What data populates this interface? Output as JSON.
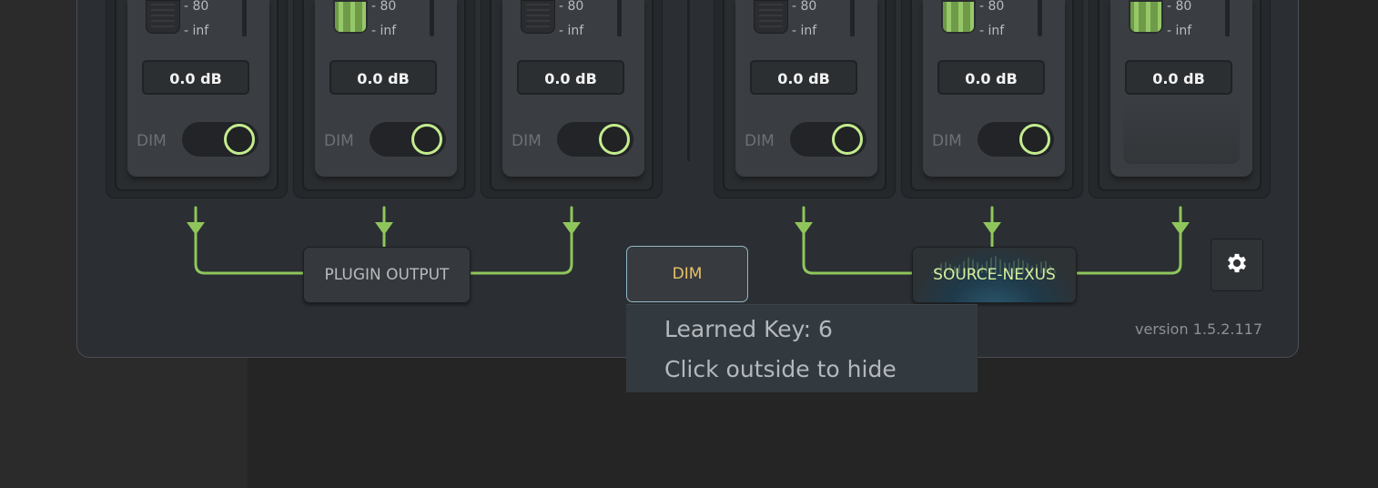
{
  "colors": {
    "accent_green": "#8fc65c",
    "toggle_ring": "#c3ec8d",
    "dim_button_text": "#e8c16a",
    "dim_button_border": "#8fb7c9",
    "source_nexus_text": "#d7ef9d",
    "panel_bg": "#2b2e32",
    "page_bg": "#252525"
  },
  "channels": [
    {
      "scale_top": "- 80",
      "scale_bottom": "- inf",
      "level": "0.0 dB",
      "dim_label": "DIM",
      "dim_on": true,
      "meter_lit": false
    },
    {
      "scale_top": "- 80",
      "scale_bottom": "- inf",
      "level": "0.0 dB",
      "dim_label": "DIM",
      "dim_on": true,
      "meter_lit": true
    },
    {
      "scale_top": "- 80",
      "scale_bottom": "- inf",
      "level": "0.0 dB",
      "dim_label": "DIM",
      "dim_on": true,
      "meter_lit": false
    },
    {
      "scale_top": "- 80",
      "scale_bottom": "- inf",
      "level": "0.0 dB",
      "dim_label": "DIM",
      "dim_on": true,
      "meter_lit": false
    },
    {
      "scale_top": "- 80",
      "scale_bottom": "- inf",
      "level": "0.0 dB",
      "dim_label": "DIM",
      "dim_on": true,
      "meter_lit": true
    },
    {
      "scale_top": "- 80",
      "scale_bottom": "- inf",
      "level": "0.0 dB",
      "dim_label": "",
      "dim_on": false,
      "meter_lit": true
    }
  ],
  "routing": {
    "plugin_output_label": "PLUGIN OUTPUT",
    "dim_button_label": "DIM",
    "source_nexus_label": "SOURCE-NEXUS"
  },
  "tooltip": {
    "line1": "Learned Key: 6",
    "line2": "Click outside to hide"
  },
  "settings": {
    "icon": "gear-icon"
  },
  "footer": {
    "version": "version 1.5.2.117"
  }
}
